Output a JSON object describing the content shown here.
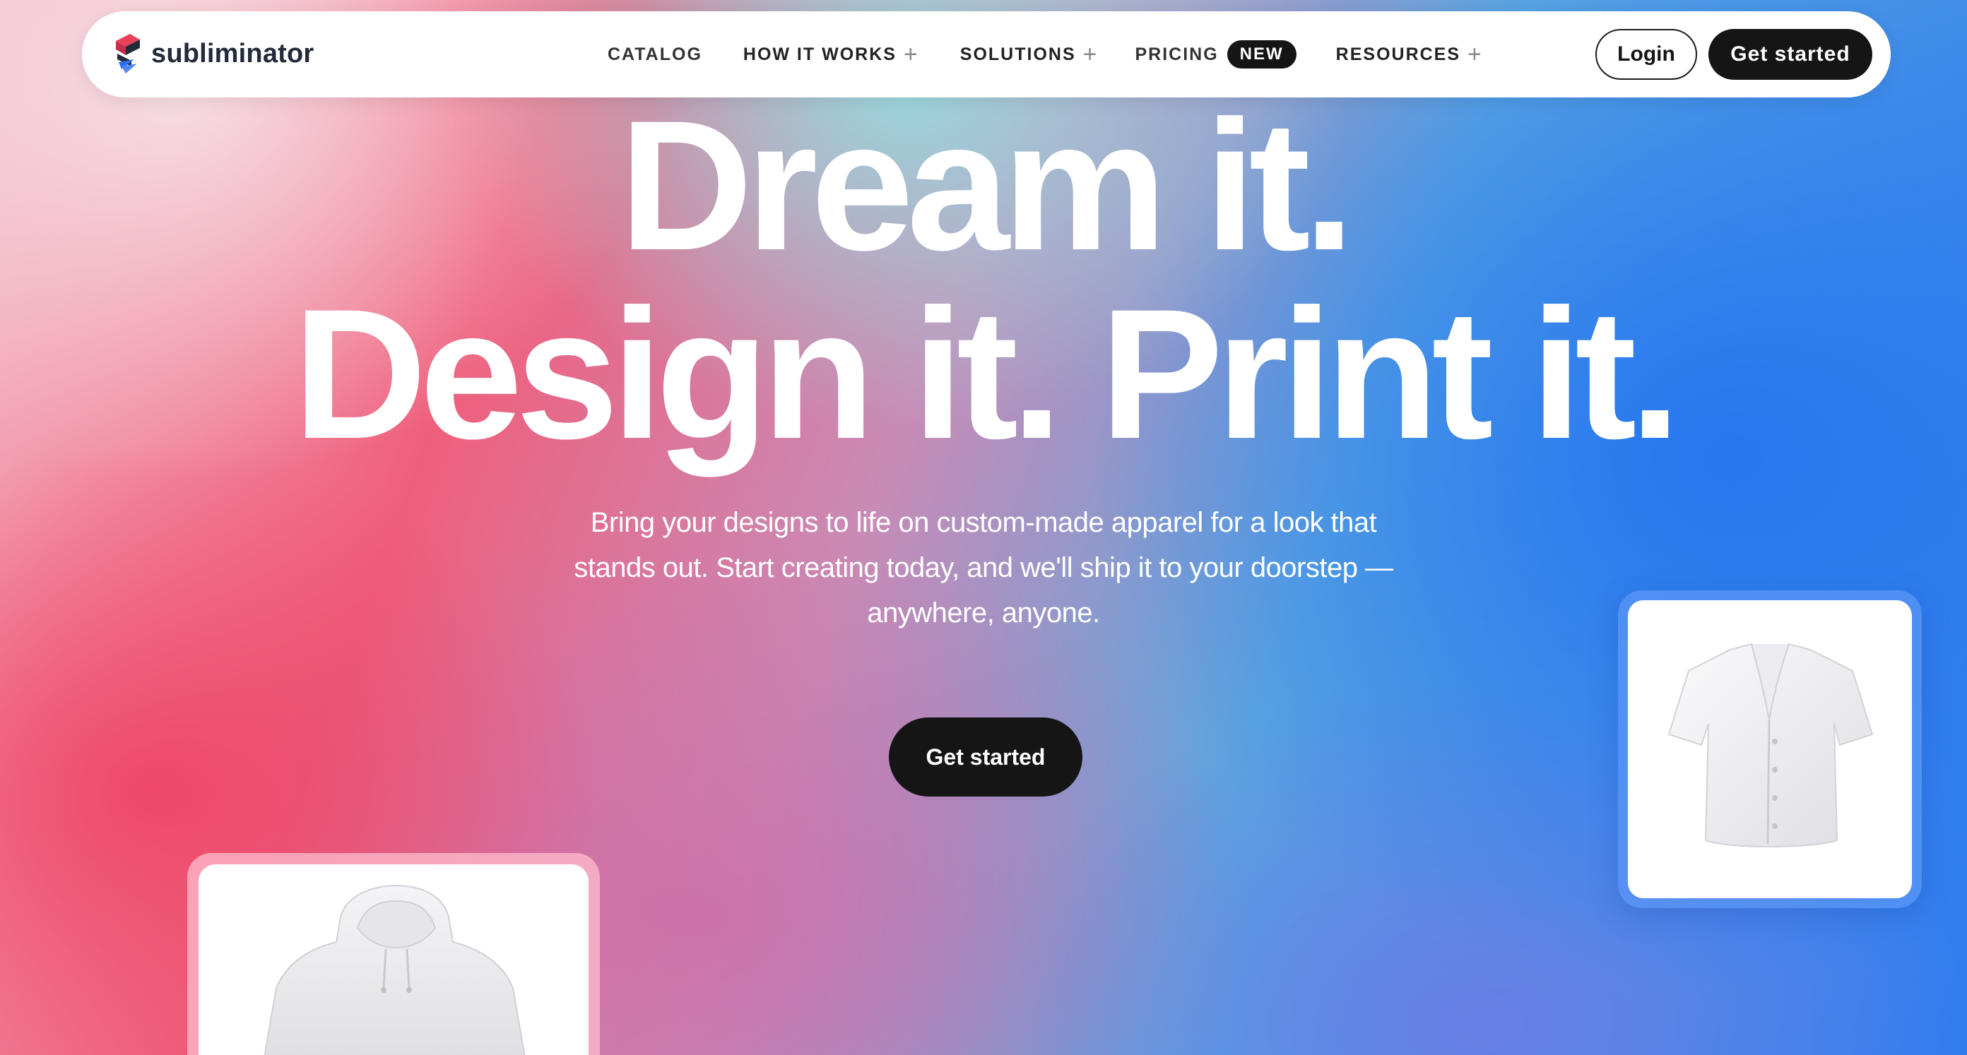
{
  "brand": {
    "name": "subliminator",
    "colors": {
      "red": "#e8425a",
      "dark": "#232a3a",
      "blue": "#2f6df0"
    }
  },
  "nav": {
    "items": [
      {
        "label": "CATALOG",
        "has_dropdown": false
      },
      {
        "label": "HOW IT WORKS",
        "has_dropdown": true
      },
      {
        "label": "SOLUTIONS",
        "has_dropdown": true
      },
      {
        "label": "PRICING",
        "has_dropdown": false,
        "badge": "NEW"
      },
      {
        "label": "RESOURCES",
        "has_dropdown": true
      }
    ],
    "plus_symbol": "+",
    "login_label": "Login",
    "cta_label": "Get started"
  },
  "hero": {
    "headline_line1": "Dream it.",
    "headline_line2": "Design it. Print it.",
    "subtext": "Bring your designs to life on custom-made apparel for a look that stands out. Start creating today, and we'll ship it to your doorstep — anywhere, anyone.",
    "cta_label": "Get started"
  },
  "products": {
    "left": {
      "icon": "hoodie-icon"
    },
    "right": {
      "icon": "baseball-jersey-icon"
    }
  }
}
